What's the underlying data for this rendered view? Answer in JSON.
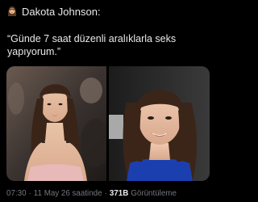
{
  "tweet": {
    "author_line": "Dakota Johnson:",
    "author_icon": "woman-emoji-icon",
    "text": "“Günde 7 saat düzenli aralıklarla seks yapıyorum.”",
    "media": [
      {
        "icon": "photo-icon",
        "name": "left-photo"
      },
      {
        "icon": "photo-icon",
        "name": "right-photo"
      }
    ],
    "meta": {
      "time": "07:30",
      "separator": "·",
      "date_text": "11 May 26 saatinde",
      "views_count": "371B",
      "views_label": "Görüntüleme"
    }
  },
  "colors": {
    "background": "#000000",
    "text_primary": "#e7e9ea",
    "text_secondary": "#71767b"
  }
}
